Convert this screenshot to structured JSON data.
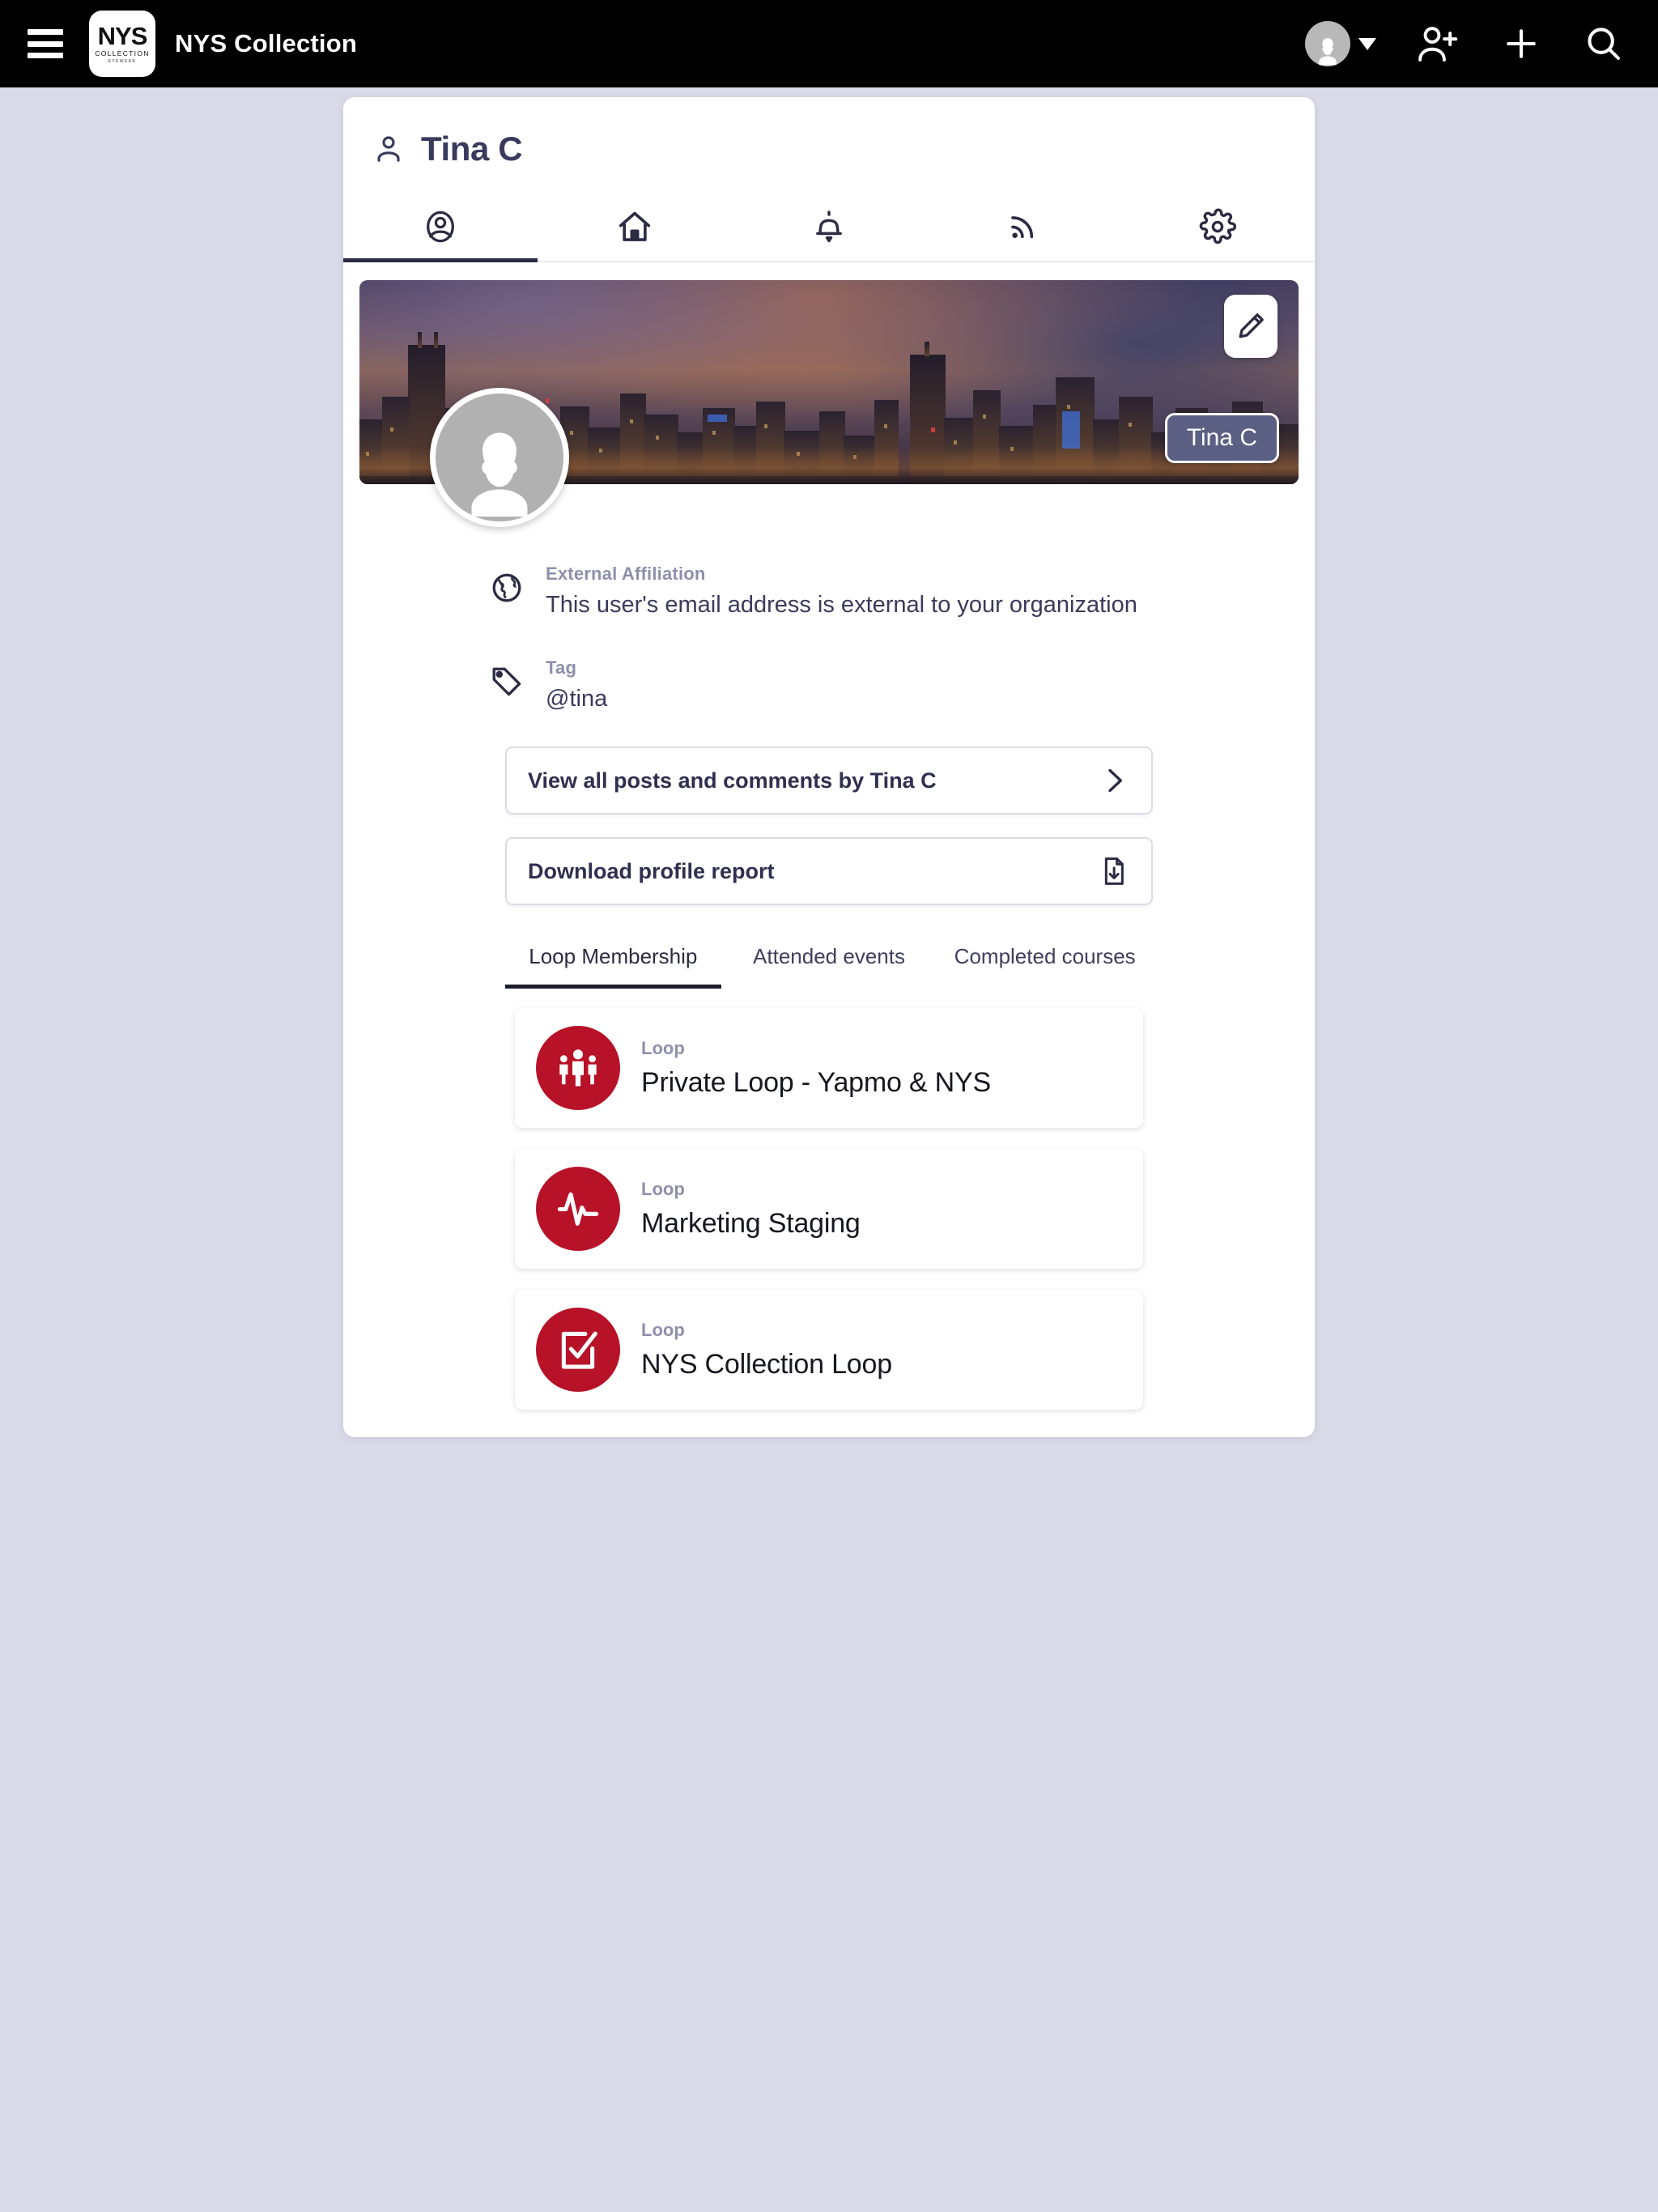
{
  "appbar": {
    "menu_icon": "hamburger-menu-icon",
    "logo": {
      "line1": "NYS",
      "line2": "COLLECTION",
      "line3": "EYEWEAR"
    },
    "title": "NYS Collection",
    "account_icon": "user-avatar-icon",
    "caret_icon": "caret-down-icon",
    "add_user_icon": "add-user-icon",
    "plus_icon": "plus-icon",
    "search_icon": "search-icon"
  },
  "profile": {
    "title": "Tina C",
    "title_icon": "person-icon",
    "cover_name_badge": "Tina C",
    "edit_icon": "pencil-edit-icon",
    "avatar_icon": "female-avatar-icon"
  },
  "tabs": [
    {
      "name": "profile",
      "icon": "user-circle-icon",
      "active": true
    },
    {
      "name": "home",
      "icon": "home-icon",
      "active": false
    },
    {
      "name": "notifications",
      "icon": "bell-icon",
      "active": false
    },
    {
      "name": "feed",
      "icon": "rss-feed-icon",
      "active": false
    },
    {
      "name": "settings",
      "icon": "gear-icon",
      "active": false
    }
  ],
  "info_rows": [
    {
      "icon": "globe-icon",
      "label": "External Affiliation",
      "value": "This user's email address is external to your organization"
    },
    {
      "icon": "tag-icon",
      "label": "Tag",
      "value": "@tina"
    }
  ],
  "actions": [
    {
      "label": "View all posts and comments by Tina C",
      "icon": "chevron-right-icon"
    },
    {
      "label": "Download profile report",
      "icon": "file-download-icon"
    }
  ],
  "subtabs": [
    {
      "label": "Loop Membership",
      "active": true
    },
    {
      "label": "Attended events",
      "active": false
    },
    {
      "label": "Completed courses",
      "active": false
    }
  ],
  "loops": [
    {
      "kicker": "Loop",
      "name": "Private Loop - Yapmo & NYS",
      "icon": "people-group-icon"
    },
    {
      "kicker": "Loop",
      "name": "Marketing Staging",
      "icon": "activity-pulse-icon"
    },
    {
      "kicker": "Loop",
      "name": "NYS Collection Loop",
      "icon": "checklist-icon"
    }
  ],
  "colors": {
    "page_background": "#dbdae8",
    "appbar_background": "#000000",
    "accent_red": "#b81228",
    "text_dark": "#2b2c42",
    "muted_label": "#8d90ab",
    "badge_slate": "#5b5f84"
  }
}
